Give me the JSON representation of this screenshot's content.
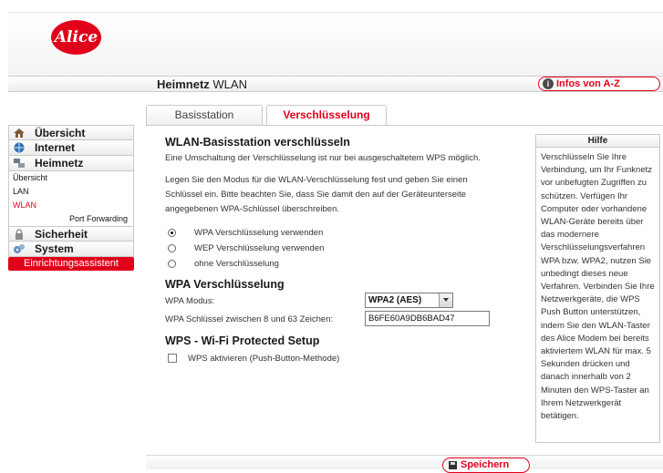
{
  "header": {
    "logo_text": "Alice",
    "title_bold": "Heimnetz",
    "title_rest": " WLAN",
    "infos_button": "Infos von A-Z"
  },
  "sidebar": {
    "items": [
      {
        "label": "Übersicht",
        "icon": "home-icon"
      },
      {
        "label": "Internet",
        "icon": "globe-icon"
      },
      {
        "label": "Heimnetz",
        "icon": "network-icon"
      }
    ],
    "subitems": [
      "Übersicht",
      "LAN",
      "WLAN",
      "Port Forwarding"
    ],
    "items2": [
      {
        "label": "Sicherheit",
        "icon": "lock-icon"
      },
      {
        "label": "System",
        "icon": "gears-icon"
      }
    ],
    "assistant": "Einrichtungsassistent"
  },
  "tabs": [
    "Basisstation",
    "Verschlüsselung"
  ],
  "main": {
    "heading": "WLAN-Basisstation verschlüsseln",
    "note": "Eine Umschaltung der Verschlüsselung ist nur bei ausgeschaltetem WPS möglich.",
    "instruction": "Legen Sie den Modus für die WLAN-Verschlüsselung fest und geben Sie einen Schlüssel ein. Bitte beachten Sie, dass Sie damit den auf der Geräteunterseite angegebenen WPA-Schlüssel überschreiben.",
    "radios": [
      {
        "label": "WPA Verschlüsselung verwenden",
        "checked": true
      },
      {
        "label": "WEP Verschlüsselung verwenden",
        "checked": false
      },
      {
        "label": "ohne Verschlüsselung",
        "checked": false
      }
    ],
    "wpa_heading": "WPA Verschlüsselung",
    "wpa_mode_label": "WPA Modus:",
    "wpa_mode_value": "WPA2 (AES)",
    "wpa_key_label": "WPA Schlüssel zwischen 8 und 63 Zeichen:",
    "wpa_key_value": "B6FE60A9DB6BAD47",
    "wps_heading": "WPS - Wi-Fi Protected Setup",
    "wps_checkbox_label": "WPS aktivieren (Push-Button-Methode)"
  },
  "help": {
    "title": "Hilfe",
    "text": "Verschlüsseln Sie Ihre Verbindung, um Ihr Funknetz vor unbefugten Zugriffen zu schützen. Verfügen Ihr Computer oder vorhandene WLAN-Geräte bereits über das modernere Verschlüsselungsverfahren WPA bzw. WPA2, nutzen Sie unbedingt dieses neue Verfahren. Verbinden Sie Ihre Netzwerkgeräte, die WPS Push Button unterstützen, indem Sie den WLAN-Taster des Alice Modem bei bereits aktiviertem WLAN für max. 5 Sekunden drücken und danach innerhalb von 2 Minuten den WPS-Taster an Ihrem Netzwerkgerät betätigen."
  },
  "footer": {
    "save_label": "Speichern"
  },
  "colors": {
    "accent": "#e1001a"
  }
}
